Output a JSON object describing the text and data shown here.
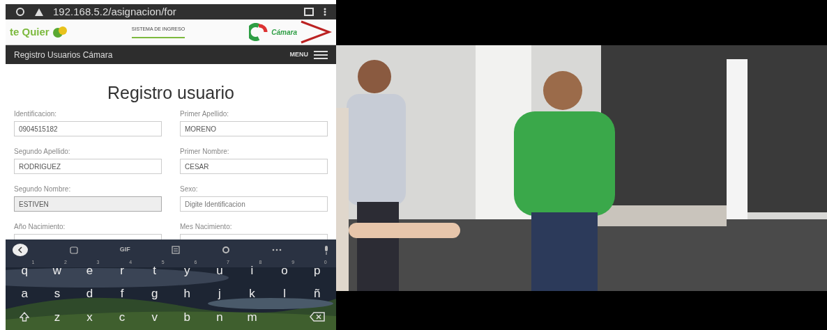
{
  "status_bar": {
    "url": "192.168.5.2/asignacion/for"
  },
  "banner": {
    "left_logo": "te Quier",
    "title": "SISTEMA DE INGRESO",
    "right_logo": "Cámara"
  },
  "navbar": {
    "title": "Registro Usuarios Cámara",
    "menu": "MENU"
  },
  "form": {
    "heading": "Registro usuario",
    "fields": [
      {
        "label": "Identificacion:",
        "value": "0904515182"
      },
      {
        "label": "Primer Apellido:",
        "value": "MORENO"
      },
      {
        "label": "Segundo Apellido:",
        "value": "RODRIGUEZ"
      },
      {
        "label": "Primer Nombre:",
        "value": "CESAR"
      },
      {
        "label": "Segundo Nombre:",
        "value": "ESTIVEN",
        "focused": true
      },
      {
        "label": "Sexo:",
        "placeholder": "Digite Identificacion",
        "focused": false
      },
      {
        "label": "Año Nacimiento:"
      },
      {
        "label": "Mes Nacimiento:"
      }
    ]
  },
  "keyboard": {
    "toolbar": [
      "GIF"
    ],
    "rows": [
      [
        {
          "key": "q",
          "hint": "1"
        },
        {
          "key": "w",
          "hint": "2"
        },
        {
          "key": "e",
          "hint": "3"
        },
        {
          "key": "r",
          "hint": "4"
        },
        {
          "key": "t",
          "hint": "5"
        },
        {
          "key": "y",
          "hint": "6"
        },
        {
          "key": "u",
          "hint": "7"
        },
        {
          "key": "i",
          "hint": "8"
        },
        {
          "key": "o",
          "hint": "9"
        },
        {
          "key": "p",
          "hint": "0"
        }
      ],
      [
        {
          "key": "a"
        },
        {
          "key": "s"
        },
        {
          "key": "d"
        },
        {
          "key": "f"
        },
        {
          "key": "g"
        },
        {
          "key": "h"
        },
        {
          "key": "j"
        },
        {
          "key": "k"
        },
        {
          "key": "l"
        },
        {
          "key": "ñ"
        }
      ],
      [
        {
          "kind": "shift"
        },
        {
          "key": "z"
        },
        {
          "key": "x"
        },
        {
          "key": "c"
        },
        {
          "key": "v"
        },
        {
          "key": "b"
        },
        {
          "key": "n"
        },
        {
          "key": "m"
        }
      ]
    ]
  }
}
